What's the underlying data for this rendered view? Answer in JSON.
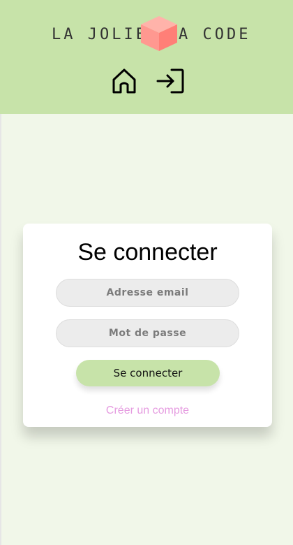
{
  "header": {
    "logo_left": "LA JOLIE",
    "logo_right": "A CODE",
    "nav": {
      "home_icon": "home-icon",
      "login_icon": "login-icon"
    }
  },
  "login_form": {
    "title": "Se connecter",
    "email_placeholder": "Adresse email",
    "password_placeholder": "Mot de passe",
    "submit_label": "Se connecter",
    "create_account_label": "Créer un compte"
  },
  "colors": {
    "header_bg": "#c7e3a9",
    "page_bg": "#f1f7e9",
    "link": "#e59be0",
    "cube": "#ff8f86"
  }
}
